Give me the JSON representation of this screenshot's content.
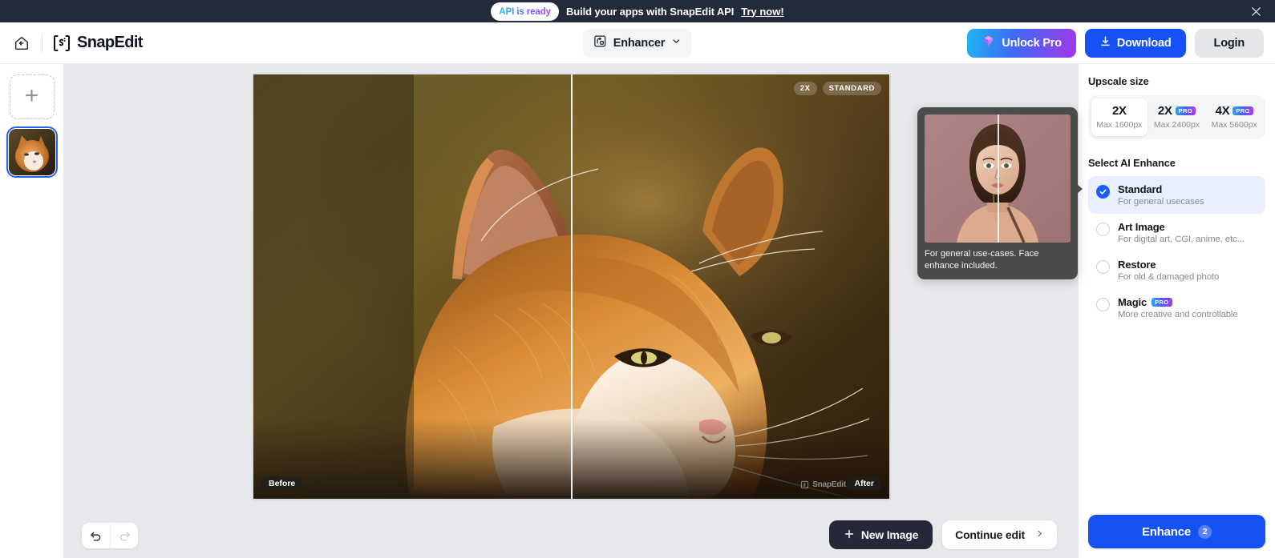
{
  "promo": {
    "badge": "API is ready",
    "text": "Build your apps with SnapEdit API",
    "link": "Try now!",
    "close_icon": "close-icon",
    "bg": "#222b3a"
  },
  "header": {
    "home_icon": "home-back-icon",
    "brand": "SnapEdit",
    "tool": {
      "icon": "enhancer-icon",
      "label": "Enhancer",
      "chevron": "chevron-down-icon"
    },
    "unlock_pro": {
      "label": "Unlock Pro",
      "icon": "gem-icon",
      "gradient": "#1fb6f0,#3d6bf5,#a336e8"
    },
    "download": {
      "label": "Download",
      "icon": "download-icon",
      "color": "#1651f5"
    },
    "login": {
      "label": "Login"
    }
  },
  "rail": {
    "add_label": "+",
    "add_name": "add-image-button",
    "thumbnail_name": "cat-thumbnail"
  },
  "canvas": {
    "badge_scale": "2X",
    "badge_mode": "STANDARD",
    "label_before": "Before",
    "label_after": "After",
    "watermark": "SnapEdit",
    "undo_icon": "undo-icon",
    "redo_icon": "redo-icon",
    "new_image": "New Image",
    "continue_edit": "Continue edit"
  },
  "tooltip": {
    "caption": "For general use-cases. Face enhance included.",
    "bg": "#4b4b4b"
  },
  "panel": {
    "upscale_title": "Upscale size",
    "upscale_options": [
      {
        "scale": "2X",
        "max": "Max 1600px",
        "pro": false,
        "selected": true
      },
      {
        "scale": "2X",
        "max": "Max 2400px",
        "pro": true,
        "selected": false
      },
      {
        "scale": "4X",
        "max": "Max 5600px",
        "pro": true,
        "selected": false
      }
    ],
    "pro_tag": "PRO",
    "enhance_title": "Select AI Enhance",
    "enhance_options": [
      {
        "name": "Standard",
        "desc": "For general usecases",
        "pro": false,
        "selected": true
      },
      {
        "name": "Art Image",
        "desc": "For digital art, CGI, anime, etc...",
        "pro": false,
        "selected": false
      },
      {
        "name": "Restore",
        "desc": "For old & damaged photo",
        "pro": false,
        "selected": false
      },
      {
        "name": "Magic",
        "desc": "More creative and controllable",
        "pro": true,
        "selected": false
      }
    ],
    "enhance_button": "Enhance",
    "enhance_credits": "2",
    "accent": "#1651f5"
  }
}
